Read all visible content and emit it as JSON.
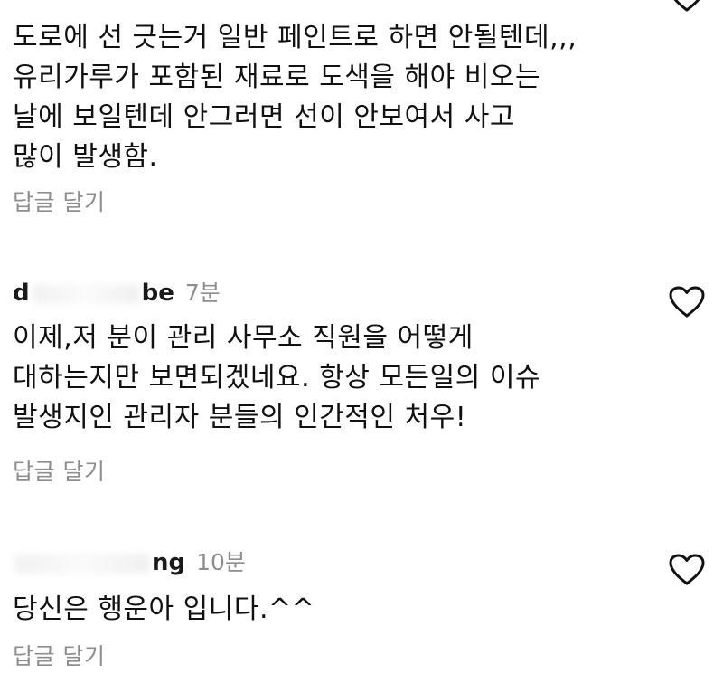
{
  "comments": [
    {
      "username_start": "",
      "username_end": "",
      "time": "",
      "text": "도로에 선 긋는거 일반 페인트로 하면 안될텐데,,,\n유리가루가 포함된 재료로 도색을 해야 비오는\n날에 보일텐데 안그러면 선이 안보여서 사고\n많이 발생함.",
      "reply_label": "답글 달기"
    },
    {
      "username_start": "d",
      "username_end": "be",
      "time": "7분",
      "text": "이제,저 분이 관리 사무소 직원을 어떻게\n대하는지만 보면되겠네요.  항상 모든일의 이슈\n발생지인 관리자 분들의 인간적인 처우!",
      "reply_label": "답글 달기"
    },
    {
      "username_start": "",
      "username_end": "ng",
      "time": "10분",
      "text": "당신은 행운아 입니다.^^",
      "reply_label": "답글 달기"
    }
  ],
  "icons": {
    "like": "heart-outline-icon"
  },
  "colors": {
    "text": "#111111",
    "secondary": "#8e8e8e",
    "background": "#ffffff"
  }
}
